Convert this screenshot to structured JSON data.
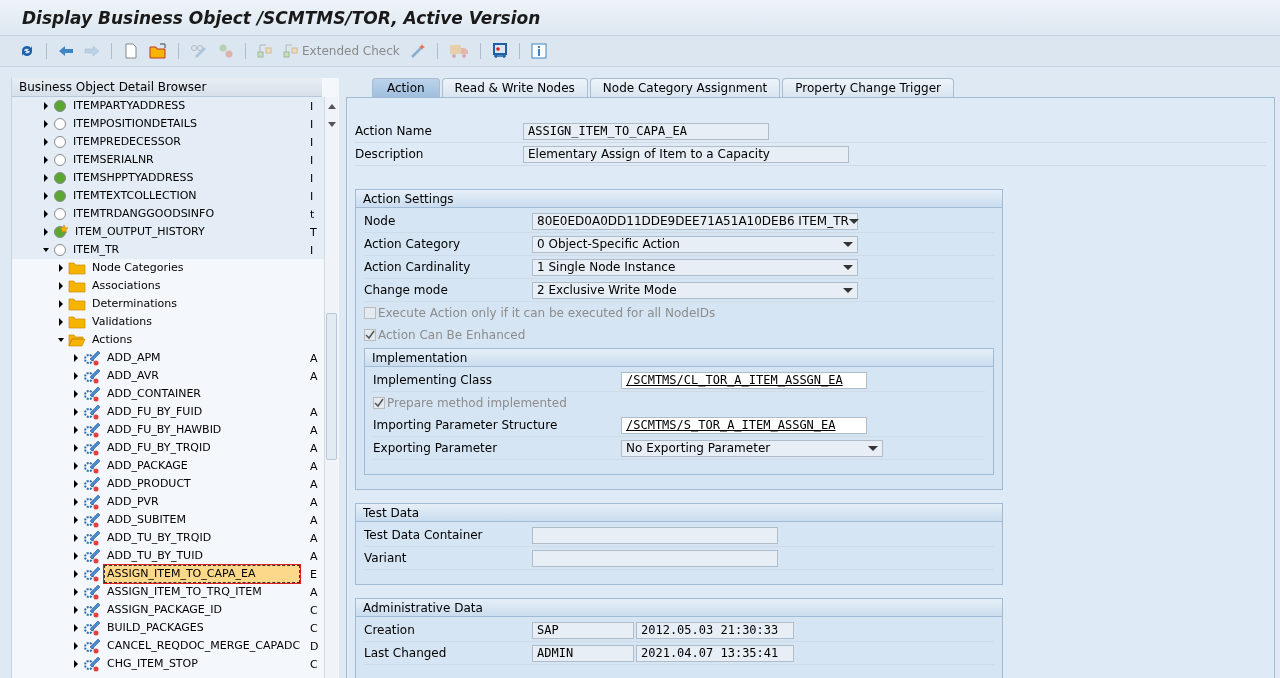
{
  "window": {
    "title": "Display Business Object /SCMTMS/TOR, Active Version"
  },
  "toolbar": [
    {
      "kind": "refresh",
      "disabled": false
    },
    {
      "kind": "sep"
    },
    {
      "kind": "back",
      "disabled": false
    },
    {
      "kind": "forward",
      "disabled": true
    },
    {
      "kind": "sep"
    },
    {
      "kind": "new",
      "disabled": false
    },
    {
      "kind": "open",
      "disabled": false
    },
    {
      "kind": "sep"
    },
    {
      "kind": "glasses",
      "disabled": true
    },
    {
      "kind": "objects",
      "disabled": true
    },
    {
      "kind": "sep"
    },
    {
      "kind": "hierarchy",
      "disabled": true
    },
    {
      "kind": "hierarchy",
      "disabled": true,
      "label": "Extended Check"
    },
    {
      "kind": "wand",
      "disabled": false
    },
    {
      "kind": "sep"
    },
    {
      "kind": "truck",
      "disabled": true
    },
    {
      "kind": "sep"
    },
    {
      "kind": "display",
      "disabled": false
    },
    {
      "kind": "sep"
    },
    {
      "kind": "info",
      "disabled": false
    }
  ],
  "tree": {
    "title": "Business Object Detail Browser",
    "nodes": [
      {
        "kind": "node",
        "color": "#5aa832",
        "label": "ITEMPARTYADDRESS",
        "column_2": "I",
        "expanded": false,
        "selected": false
      },
      {
        "kind": "node",
        "color": "#ffffff",
        "label": "ITEMPOSITIONDETAILS",
        "column_2": "I",
        "expanded": false,
        "selected": false
      },
      {
        "kind": "node",
        "color": "#ffffff",
        "label": "ITEMPREDECESSOR",
        "column_2": "I",
        "expanded": false,
        "selected": false
      },
      {
        "kind": "node",
        "color": "#ffffff",
        "label": "ITEMSERIALNR",
        "column_2": "I",
        "expanded": false,
        "selected": false
      },
      {
        "kind": "node",
        "color": "#5aa832",
        "label": "ITEMSHPPTYADDRESS",
        "column_2": "I",
        "expanded": false,
        "selected": false
      },
      {
        "kind": "node",
        "color": "#5aa832",
        "label": "ITEMTEXTCOLLECTION",
        "column_2": "I",
        "expanded": false,
        "selected": false
      },
      {
        "kind": "node",
        "color": "#ffffff",
        "label": "ITEMTRDANGGOODSINFO",
        "column_2": "t",
        "expanded": false,
        "selected": false
      },
      {
        "kind": "new-node",
        "color": "#5aa832",
        "label": "ITEM_OUTPUT_HISTORY",
        "column_2": "T",
        "expanded": false,
        "selected": false
      },
      {
        "kind": "node",
        "color": "#ffffff",
        "label": "ITEM_TR",
        "column_2": "I",
        "expanded": true,
        "selected": false,
        "children": [
          {
            "kind": "folder",
            "label": "Node Categories",
            "expanded": false,
            "selected": false
          },
          {
            "kind": "folder",
            "label": "Associations",
            "expanded": false,
            "selected": false
          },
          {
            "kind": "folder",
            "label": "Determinations",
            "expanded": false,
            "selected": false
          },
          {
            "kind": "folder",
            "label": "Validations",
            "expanded": false,
            "selected": false
          },
          {
            "kind": "folder",
            "label": "Actions",
            "expanded": true,
            "selected": false,
            "children": [
              {
                "kind": "action",
                "label": "ADD_APM",
                "column_2": "A",
                "expanded": false,
                "selected": false
              },
              {
                "kind": "action",
                "label": "ADD_AVR",
                "column_2": "A",
                "expanded": false,
                "selected": false
              },
              {
                "kind": "action",
                "label": "ADD_CONTAINER",
                "expanded": false,
                "selected": false
              },
              {
                "kind": "action",
                "label": "ADD_FU_BY_FUID",
                "column_2": "A",
                "expanded": false,
                "selected": false
              },
              {
                "kind": "action",
                "label": "ADD_FU_BY_HAWBID",
                "column_2": "A",
                "expanded": false,
                "selected": false
              },
              {
                "kind": "action",
                "label": "ADD_FU_BY_TRQID",
                "column_2": "A",
                "expanded": false,
                "selected": false
              },
              {
                "kind": "action",
                "label": "ADD_PACKAGE",
                "column_2": "A",
                "expanded": false,
                "selected": false
              },
              {
                "kind": "action",
                "label": "ADD_PRODUCT",
                "column_2": "A",
                "expanded": false,
                "selected": false
              },
              {
                "kind": "action",
                "label": "ADD_PVR",
                "column_2": "A",
                "expanded": false,
                "selected": false
              },
              {
                "kind": "action",
                "label": "ADD_SUBITEM",
                "column_2": "A",
                "expanded": false,
                "selected": false
              },
              {
                "kind": "action",
                "label": "ADD_TU_BY_TRQID",
                "column_2": "A",
                "expanded": false,
                "selected": false
              },
              {
                "kind": "action",
                "label": "ADD_TU_BY_TUID",
                "column_2": "A",
                "expanded": false,
                "selected": false
              },
              {
                "kind": "action",
                "label": "ASSIGN_ITEM_TO_CAPA_EA",
                "column_2": "E",
                "expanded": false,
                "selected": true
              },
              {
                "kind": "action",
                "label": "ASSIGN_ITEM_TO_TRQ_ITEM",
                "column_2": "A",
                "expanded": false,
                "selected": false
              },
              {
                "kind": "action",
                "label": "ASSIGN_PACKAGE_ID",
                "column_2": "C",
                "expanded": false,
                "selected": false
              },
              {
                "kind": "action",
                "label": "BUILD_PACKAGES",
                "column_2": "C",
                "expanded": false,
                "selected": false
              },
              {
                "kind": "action",
                "label": "CANCEL_REQDOC_MERGE_CAPADC",
                "column_2": "D",
                "expanded": false,
                "selected": false
              },
              {
                "kind": "action",
                "label": "CHG_ITEM_STOP",
                "column_2": "C",
                "expanded": false,
                "selected": false
              }
            ]
          }
        ]
      }
    ]
  },
  "tabs": [
    {
      "label": "Action",
      "selected": true
    },
    {
      "label": "Read & Write Nodes",
      "selected": false
    },
    {
      "label": "Node Category Assignment",
      "selected": false
    },
    {
      "label": "Property Change Trigger",
      "selected": false
    }
  ],
  "header_fields": [
    {
      "label": "Action Name",
      "value": "ASSIGN_ITEM_TO_CAPA_EA",
      "kind": "mono"
    },
    {
      "label": "Description",
      "value": "Elementary Assign of Item to a Capacity",
      "kind": "text"
    }
  ],
  "action_settings": {
    "title": "Action Settings",
    "fields": [
      {
        "label": "Node",
        "value": "80E0ED0A0DD11DDE9DEE71A51A10DEB6 ITEM_TR",
        "kind": "dropdown"
      },
      {
        "label": "Action Category",
        "value": "0 Object-Specific Action",
        "kind": "dropdown"
      },
      {
        "label": "Action Cardinality",
        "value": "1 Single Node Instance",
        "kind": "dropdown"
      },
      {
        "label": "Change mode",
        "value": "2 Exclusive Write Mode",
        "kind": "dropdown"
      }
    ],
    "checkboxes": [
      {
        "label": "Execute Action only if it can be executed for all NodeIDs",
        "checked": false,
        "disabled": true
      },
      {
        "label": "Action Can Be Enhanced",
        "checked": true,
        "disabled": true
      }
    ],
    "implementation": {
      "title": "Implementation",
      "rows": [
        {
          "kind": "link",
          "label": "Implementing Class",
          "value": "/SCMTMS/CL_TOR_A_ITEM_ASSGN_EA"
        },
        {
          "kind": "checkbox",
          "label": "Prepare method implemented",
          "checked": true,
          "disabled": true
        },
        {
          "kind": "link",
          "label": "Importing Parameter Structure",
          "value": "/SCMTMS/S_TOR_A_ITEM_ASSGN_EA"
        },
        {
          "kind": "dropdown",
          "label": "Exporting Parameter",
          "value": "No Exporting Parameter"
        }
      ]
    }
  },
  "test_data": {
    "title": "Test Data",
    "fields": [
      {
        "label": "Test Data Container"
      },
      {
        "label": "Variant"
      }
    ]
  },
  "administrative_data": {
    "title": "Administrative Data",
    "rows": [
      {
        "label": "Creation",
        "user": "SAP",
        "timestamp": "2012.05.03 21:30:33"
      },
      {
        "label": "Last Changed",
        "user": "ADMIN",
        "timestamp": "2021.04.07 13:35:41"
      }
    ]
  }
}
